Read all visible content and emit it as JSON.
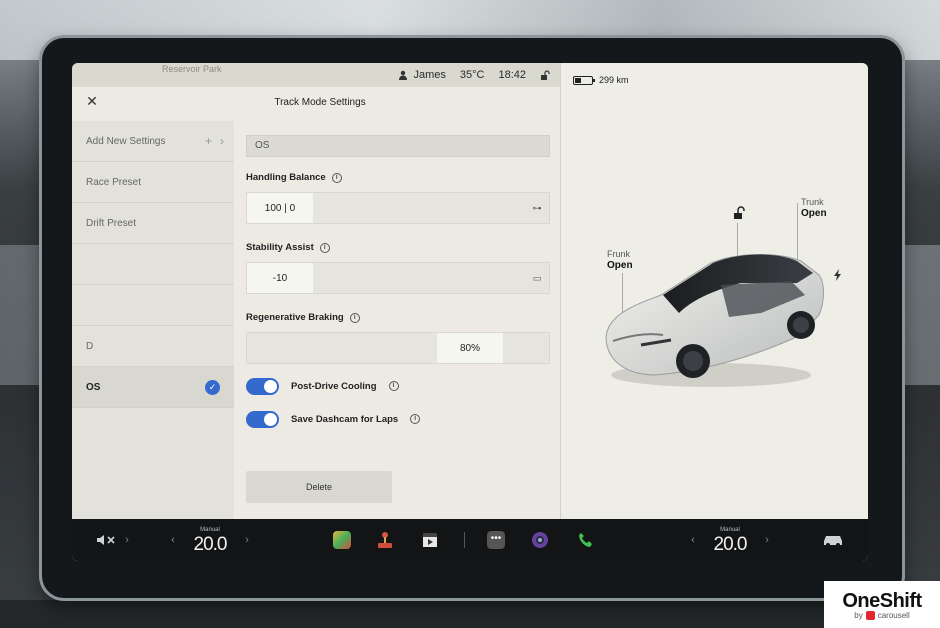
{
  "status_bar": {
    "map_label": "Reservoir Park",
    "user": "James",
    "temperature": "35°C",
    "time": "18:42"
  },
  "settings": {
    "title": "Track Mode Settings",
    "presets": [
      {
        "label": "Add New Settings",
        "type": "add"
      },
      {
        "label": "Race Preset"
      },
      {
        "label": "Drift Preset"
      },
      {
        "label": ""
      },
      {
        "label": ""
      },
      {
        "label": "D"
      },
      {
        "label": "OS",
        "selected": true
      }
    ],
    "name_value": "OS",
    "handling_balance": {
      "label": "Handling Balance",
      "value": "100 | 0"
    },
    "stability_assist": {
      "label": "Stability Assist",
      "value": "-10"
    },
    "regen_braking": {
      "label": "Regenerative Braking",
      "value": "80%",
      "level": 0.8
    },
    "post_drive_cooling": {
      "label": "Post-Drive Cooling",
      "on": true
    },
    "save_dashcam": {
      "label": "Save Dashcam for Laps",
      "on": true
    },
    "delete_label": "Delete"
  },
  "car": {
    "range": "299 km",
    "frunk": {
      "label": "Frunk",
      "state": "Open"
    },
    "trunk": {
      "label": "Trunk",
      "state": "Open"
    }
  },
  "taskbar": {
    "left_temp": {
      "mode": "Manual",
      "value": "20.0"
    },
    "right_temp": {
      "mode": "Manual",
      "value": "20.0"
    }
  },
  "watermark": {
    "brand": "OneShift",
    "by": "by",
    "partner": "carousell"
  },
  "colors": {
    "accent": "#2f6ad9",
    "screen_bg": "#e9e9e0",
    "taskbar": "#121416"
  }
}
